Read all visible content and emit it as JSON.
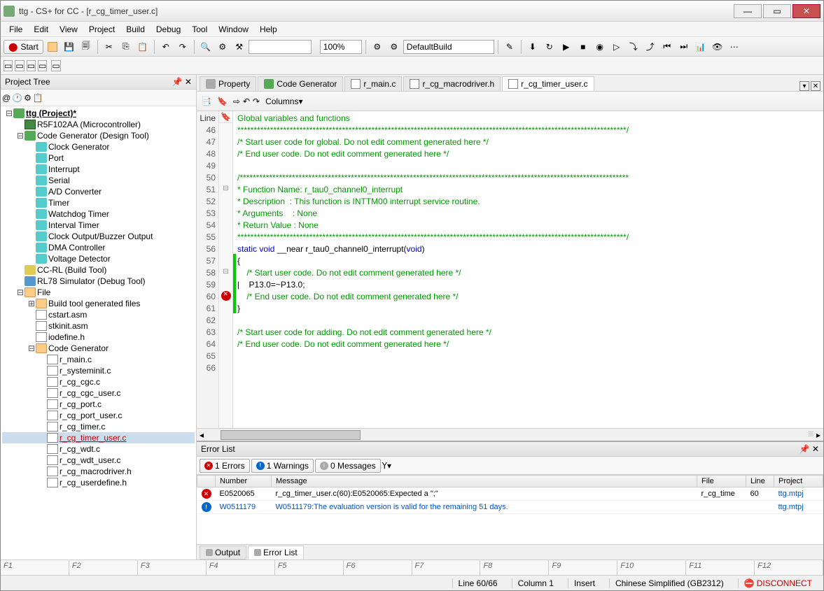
{
  "window": {
    "title": "ttg - CS+ for CC - [r_cg_timer_user.c]"
  },
  "menu": [
    "File",
    "Edit",
    "View",
    "Project",
    "Build",
    "Debug",
    "Tool",
    "Window",
    "Help"
  ],
  "toolbar": {
    "start": "Start",
    "zoom": "100%",
    "build_config": "DefaultBuild",
    "columns": "Columns"
  },
  "project_tree": {
    "title": "Project Tree",
    "root": "ttg (Project)*",
    "nodes": [
      "R5F102AA (Microcontroller)",
      "Code Generator (Design Tool)",
      "Clock Generator",
      "Port",
      "Interrupt",
      "Serial",
      "A/D Converter",
      "Timer",
      "Watchdog Timer",
      "Interval Timer",
      "Clock Output/Buzzer Output",
      "DMA Controller",
      "Voltage Detector",
      "CC-RL (Build Tool)",
      "RL78 Simulator (Debug Tool)",
      "File",
      "Build tool generated files",
      "cstart.asm",
      "stkinit.asm",
      "iodefine.h",
      "Code Generator",
      "r_main.c",
      "r_systeminit.c",
      "r_cg_cgc.c",
      "r_cg_cgc_user.c",
      "r_cg_port.c",
      "r_cg_port_user.c",
      "r_cg_timer.c",
      "r_cg_timer_user.c",
      "r_cg_wdt.c",
      "r_cg_wdt_user.c",
      "r_cg_macrodriver.h",
      "r_cg_userdefine.h"
    ]
  },
  "tabs": [
    {
      "label": "Property"
    },
    {
      "label": "Code Generator"
    },
    {
      "label": "r_main.c"
    },
    {
      "label": "r_cg_macrodriver.h"
    },
    {
      "label": "r_cg_timer_user.c",
      "active": true
    }
  ],
  "editor": {
    "gutter_header": "Line",
    "lines": [
      {
        "n": 46,
        "cls": "c-comment",
        "text": "Global variables and functions"
      },
      {
        "n": 47,
        "cls": "c-comment",
        "text": "***********************************************************************************************************************/"
      },
      {
        "n": 48,
        "cls": "c-comment",
        "text": "/* Start user code for global. Do not edit comment generated here */"
      },
      {
        "n": 49,
        "cls": "c-comment",
        "text": "/* End user code. Do not edit comment generated here */"
      },
      {
        "n": 50,
        "cls": "",
        "text": ""
      },
      {
        "n": 51,
        "cls": "c-comment",
        "text": "/***********************************************************************************************************************"
      },
      {
        "n": 52,
        "cls": "c-comment",
        "text": "* Function Name: r_tau0_channel0_interrupt"
      },
      {
        "n": 53,
        "cls": "c-comment",
        "text": "* Description  : This function is INTTM00 interrupt service routine."
      },
      {
        "n": 54,
        "cls": "c-comment",
        "text": "* Arguments    : None"
      },
      {
        "n": 55,
        "cls": "c-comment",
        "text": "* Return Value : None"
      },
      {
        "n": 56,
        "cls": "c-comment",
        "text": "***********************************************************************************************************************/"
      },
      {
        "n": 57,
        "cls": "",
        "html": "<span class='c-keyword'>static</span> <span class='c-keyword'>void</span> <span class='c-black'>__near r_tau0_channel0_interrupt(</span><span class='c-keyword'>void</span><span class='c-black'>)</span>"
      },
      {
        "n": 58,
        "cls": "c-black",
        "text": "{"
      },
      {
        "n": 59,
        "cls": "c-comment",
        "text": "    /* Start user code. Do not edit comment generated here */"
      },
      {
        "n": 60,
        "cls": "c-black",
        "text": "|    P13.0=~P13.0;",
        "err": true
      },
      {
        "n": 61,
        "cls": "c-comment",
        "text": "    /* End user code. Do not edit comment generated here */"
      },
      {
        "n": 62,
        "cls": "c-black",
        "text": "}"
      },
      {
        "n": 63,
        "cls": "",
        "text": ""
      },
      {
        "n": 64,
        "cls": "c-comment",
        "text": "/* Start user code for adding. Do not edit comment generated here */"
      },
      {
        "n": 65,
        "cls": "c-comment",
        "text": "/* End user code. Do not edit comment generated here */"
      },
      {
        "n": 66,
        "cls": "",
        "text": ""
      }
    ]
  },
  "error_list": {
    "title": "Error List",
    "filters": {
      "errors": "1 Errors",
      "warnings": "1 Warnings",
      "messages": "0 Messages"
    },
    "columns": [
      "",
      "Number",
      "Message",
      "File",
      "Line",
      "Project"
    ],
    "rows": [
      {
        "type": "error",
        "number": "E0520065",
        "message": "r_cg_timer_user.c(60):E0520065:Expected a \";\"",
        "file": "r_cg_time",
        "line": "60",
        "project": "ttg.mtpj"
      },
      {
        "type": "warn",
        "number": "W0511179",
        "message": "W0511179:The evaluation version is valid for the remaining 51 days.",
        "file": "",
        "line": "",
        "project": "ttg.mtpj"
      }
    ],
    "bottom_tabs": [
      "Output",
      "Error List"
    ]
  },
  "fkeys": [
    "F1",
    "F2",
    "F3",
    "F4",
    "F5",
    "F6",
    "F7",
    "F8",
    "F9",
    "F10",
    "F11",
    "F12"
  ],
  "status": {
    "linecol": "Line 60/66",
    "column": "Column 1",
    "insert": "Insert",
    "encoding": "Chinese Simplified (GB2312)",
    "connect": "DISCONNECT"
  }
}
